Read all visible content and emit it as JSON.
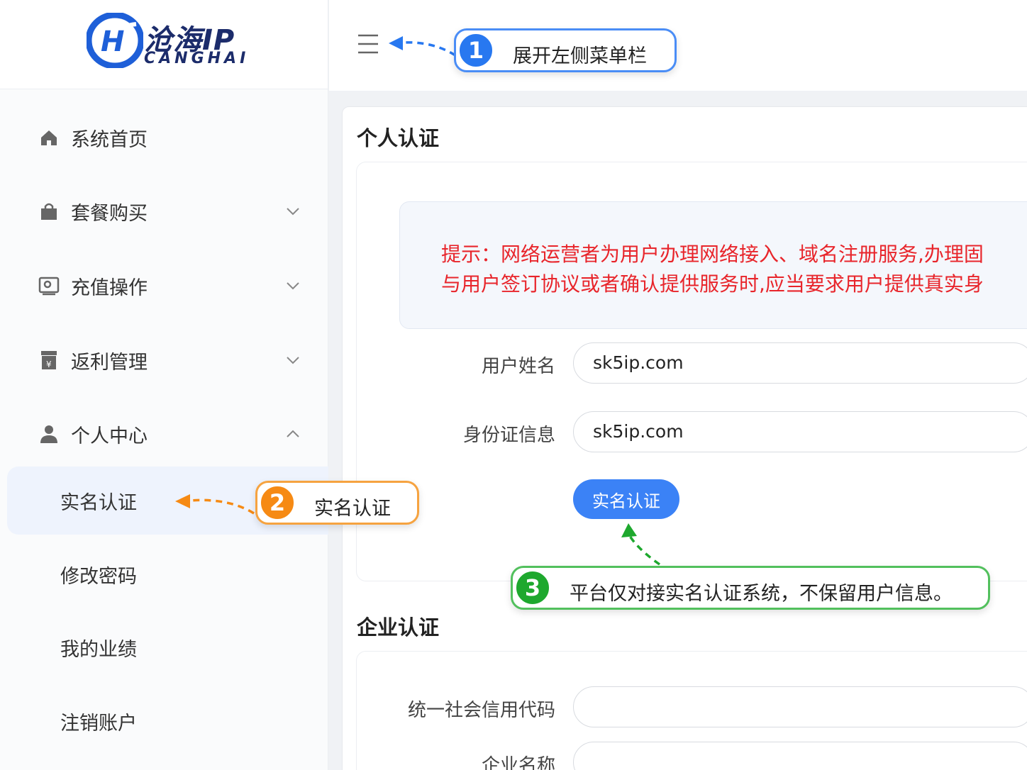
{
  "logo": {
    "cn": "沧海IP",
    "en": "CANGHAI"
  },
  "sidebar": {
    "items": [
      {
        "label": "系统首页",
        "icon": "home-icon"
      },
      {
        "label": "套餐购买",
        "icon": "shopping-bag-icon"
      },
      {
        "label": "充值操作",
        "icon": "recharge-icon"
      },
      {
        "label": "返利管理",
        "icon": "rebate-icon"
      },
      {
        "label": "个人中心",
        "icon": "user-icon"
      }
    ],
    "sub_items": [
      {
        "label": "实名认证"
      },
      {
        "label": "修改密码"
      },
      {
        "label": "我的业绩"
      },
      {
        "label": "注销账户"
      }
    ]
  },
  "callouts": {
    "c1": {
      "num": "1",
      "text": "展开左侧菜单栏"
    },
    "c2": {
      "num": "2",
      "text": "实名认证"
    },
    "c3": {
      "num": "3",
      "text": "平台仅对接实名认证系统，不保留用户信息。"
    }
  },
  "personal": {
    "title": "个人认证",
    "notice_line1": "提示：网络运营者为用户办理网络接入、域名注册服务,办理固",
    "notice_line2": "与用户签订协议或者确认提供服务时,应当要求用户提供真实身",
    "name_label": "用户姓名",
    "name_value": "sk5ip.com",
    "id_label": "身份证信息",
    "id_value": "sk5ip.com",
    "button": "实名认证"
  },
  "enterprise": {
    "title": "企业认证",
    "code_label": "统一社会信用代码",
    "name_label": "企业名称"
  },
  "colors": {
    "accent": "#3b82f6",
    "warning": "#e8252b",
    "orange": "#f68a14",
    "green": "#1ea82e"
  }
}
